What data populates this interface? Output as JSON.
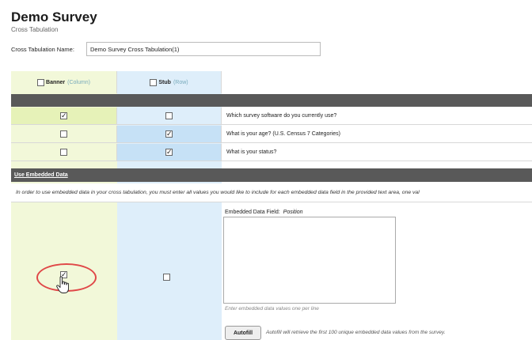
{
  "page": {
    "title": "Demo Survey",
    "subtitle": "Cross Tabulation"
  },
  "form": {
    "name_label": "Cross Tabulation Name:",
    "name_value": "Demo Survey Cross Tabulation(1)"
  },
  "columns": {
    "banner": {
      "label": "Banner",
      "sub": "(Column)"
    },
    "stub": {
      "label": "Stub",
      "sub": "(Row)"
    }
  },
  "questions": [
    {
      "text": "Which survey software do you currently use?",
      "banner": true,
      "stub": false
    },
    {
      "text": "What is your age? (U.S. Census 7 Categories)",
      "banner": false,
      "stub": true
    },
    {
      "text": "What is your status?",
      "banner": false,
      "stub": true
    }
  ],
  "embedded": {
    "header": "Use Embedded Data",
    "note": "In order to use embedded data in your cross tabulation, you must enter all values you would like to include for each embedded data field in the provided text area, one val",
    "field_label": "Embedded Data Field:",
    "field_value": "Position",
    "help": "Enter embedded data values one per line",
    "autofill_label": "Autofill",
    "autofill_text": "Autofill will retrieve the first 100 unique embedded data values from the survey.",
    "banner_checked": true,
    "stub_checked": false
  },
  "colors": {
    "banner_bg": "#f2f8d9",
    "stub_bg": "#deeefa",
    "bar": "#595959",
    "highlight": "#e04848"
  }
}
